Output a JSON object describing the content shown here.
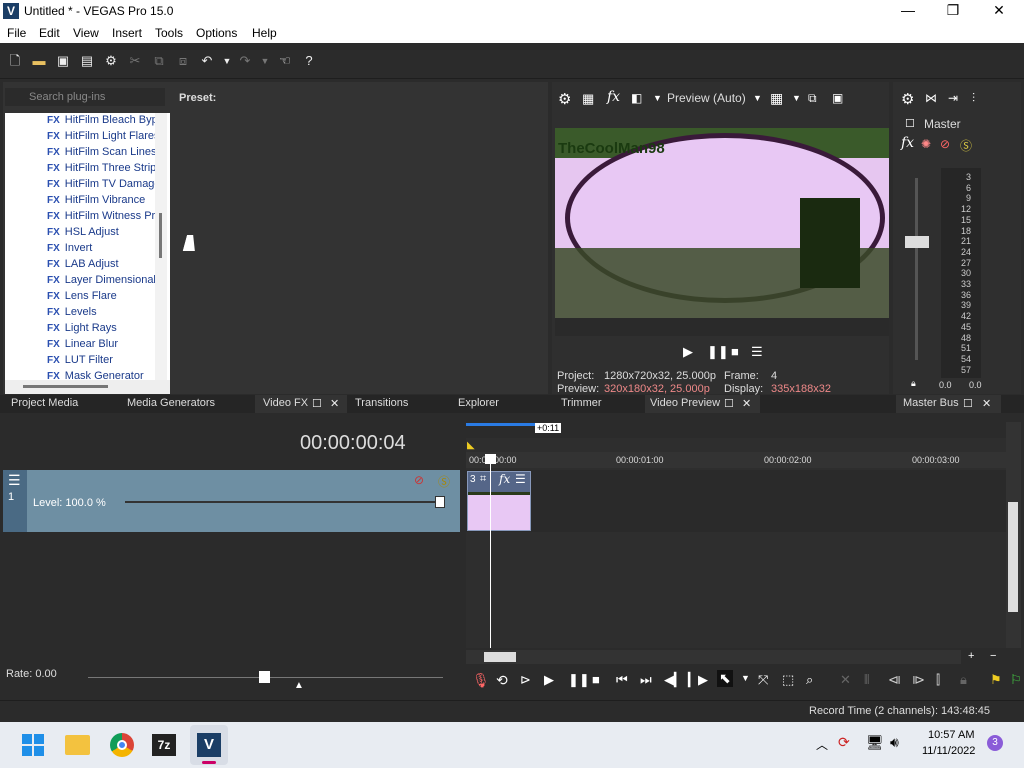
{
  "window": {
    "title": "Untitled * - VEGAS Pro 15.0",
    "logo": "V",
    "minimize": "—",
    "maximize": "❐",
    "close": "✕"
  },
  "menu": [
    "File",
    "Edit",
    "View",
    "Insert",
    "Tools",
    "Options",
    "Help"
  ],
  "fx_panel": {
    "search_placeholder": "Search plug-ins",
    "preset_label": "Preset:",
    "items": [
      "HitFilm Bleach Bypass",
      "HitFilm Light Flares",
      "HitFilm Scan Lines",
      "HitFilm Three Strip",
      "HitFilm TV Damage",
      "HitFilm Vibrance",
      "HitFilm Witness Protection",
      "HSL Adjust",
      "Invert",
      "LAB Adjust",
      "Layer Dimensional",
      "Lens Flare",
      "Levels",
      "Light Rays",
      "Linear Blur",
      "LUT Filter",
      "Mask Generator"
    ],
    "badge": "FX"
  },
  "tabs": {
    "project_media": "Project Media",
    "media_generators": "Media Generators",
    "video_fx": "Video FX",
    "transitions": "Transitions",
    "explorer": "Explorer",
    "trimmer": "Trimmer",
    "video_preview": "Video Preview",
    "master_bus": "Master Bus"
  },
  "preview": {
    "mode": "Preview (Auto)",
    "project": "Project:",
    "project_val": "1280x720x32, 25.000p",
    "preview": "Preview:",
    "preview_val": "320x180x32, 25.000p",
    "frame": "Frame:",
    "frame_val": "4",
    "display": "Display:",
    "display_val": "335x188x32",
    "overlay_text": "TheCoolMan98"
  },
  "master": {
    "label": "Master",
    "meter_scale": [
      "3",
      "6",
      "9",
      "12",
      "15",
      "18",
      "21",
      "24",
      "27",
      "30",
      "33",
      "36",
      "39",
      "42",
      "45",
      "48",
      "51",
      "54",
      "57"
    ],
    "left_val": "0.0",
    "right_val": "0.0"
  },
  "timeline": {
    "timecode": "00:00:00:04",
    "level": "Level: 100.0 %",
    "track_num": "1",
    "clip_num": "3",
    "selection": "+0:11",
    "ruler": [
      "00:00:00:00",
      "00:00:01:00",
      "00:00:02:00",
      "00:00:03:00"
    ],
    "rate": "Rate: 0.00"
  },
  "status": {
    "record_time": "Record Time (2 channels): 143:48:45"
  },
  "taskbar": {
    "time": "10:57 AM",
    "date": "11/11/2022",
    "notif": "3"
  }
}
